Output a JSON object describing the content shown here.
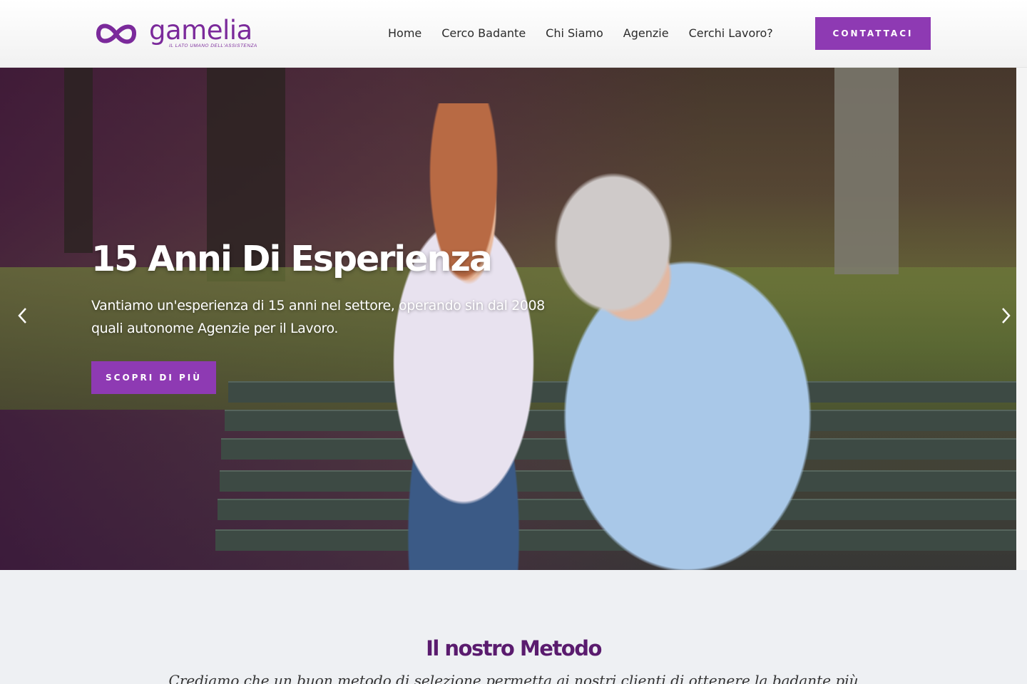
{
  "header": {
    "logo_word": "gamelia",
    "logo_tagline": "IL LATO UMANO DELL'ASSISTENZA",
    "nav": [
      "Home",
      "Cerco Badante",
      "Chi Siamo",
      "Agenzie",
      "Cerchi Lavoro?"
    ],
    "cta_label": "CONTATTACI"
  },
  "hero": {
    "title": "15 Anni Di Esperienza",
    "text": "Vantiamo un'esperienza di 15 anni nel settore, operando sin dal 2008 quali autonome Agenzie per il Lavoro.",
    "cta_label": "SCOPRI DI PIÙ",
    "prev_icon": "chevron-left-icon",
    "next_icon": "chevron-right-icon"
  },
  "method": {
    "title": "Il nostro Metodo",
    "text": "Crediamo che un buon metodo di selezione permetta ai nostri clienti di ottenere la badante più"
  },
  "colors": {
    "brand": "#8e3ab3",
    "brand_dark": "#5a1b6e",
    "section_bg": "#eef0f3"
  }
}
